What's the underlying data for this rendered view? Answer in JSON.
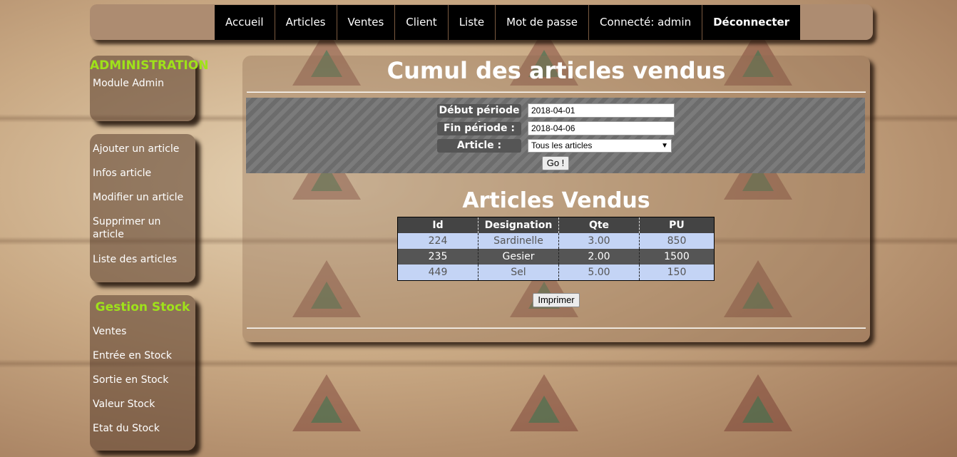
{
  "nav": {
    "items": [
      "Accueil",
      "Articles",
      "Ventes",
      "Client",
      "Liste",
      "Mot de passe",
      "Connecté: admin",
      "Déconnecter"
    ]
  },
  "sidebar": {
    "admin": {
      "title": "ADMINISTRATION",
      "items": [
        "Module Admin"
      ]
    },
    "articles": {
      "items": [
        "Ajouter un article",
        "Infos article",
        "Modifier un article",
        "Supprimer un article",
        "Liste des articles"
      ]
    },
    "stock": {
      "title": "Gestion Stock",
      "items": [
        "Ventes",
        "Entrée en Stock",
        "Sortie en Stock",
        "Valeur Stock",
        "Etat du Stock"
      ]
    }
  },
  "main": {
    "title": "Cumul des articles vendus",
    "form": {
      "debut_label": "Début période :",
      "debut_value": "2018-04-01",
      "fin_label": "Fin période :",
      "fin_value": "2018-04-06",
      "article_label": "Article :",
      "article_value": "Tous les articles",
      "go_label": "Go !"
    },
    "subtitle": "Articles Vendus",
    "table": {
      "headers": [
        "Id",
        "Designation",
        "Qte",
        "PU"
      ],
      "rows": [
        [
          "224",
          "Sardinelle",
          "3.00",
          "850"
        ],
        [
          "235",
          "Gesier",
          "2.00",
          "1500"
        ],
        [
          "449",
          "Sel",
          "5.00",
          "150"
        ]
      ]
    },
    "print_label": "Imprimer"
  }
}
